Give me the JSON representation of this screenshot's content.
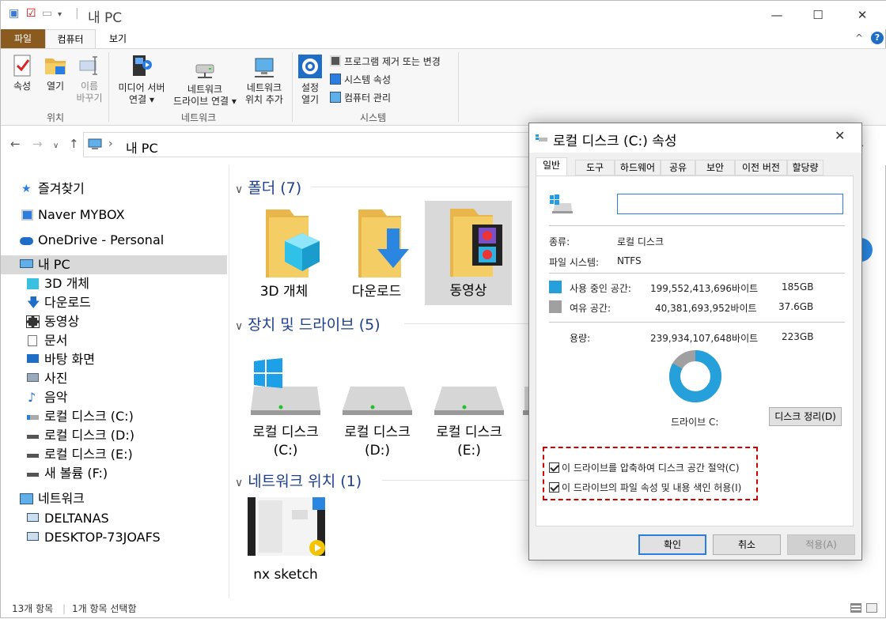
{
  "window": {
    "title": "내 PC",
    "minimize": "—",
    "maximize": "☐",
    "close": "✕"
  },
  "ribbon": {
    "tabs": [
      "파일",
      "컴퓨터",
      "보기"
    ],
    "buttons": {
      "properties": "속성",
      "open": "열기",
      "rename_1": "이름",
      "rename_2": "바꾸기",
      "media_1": "미디어 서버",
      "media_2": "연결",
      "netdrive_1": "네트워크",
      "netdrive_2": "드라이브 연결",
      "netloc_1": "네트워크",
      "netloc_2": "위치 추가",
      "settings_1": "설정",
      "settings_2": "열기",
      "uninstall": "프로그램 제거 또는 변경",
      "sysprops": "시스템 속성",
      "manage": "컴퓨터 관리"
    },
    "groups": {
      "location": "위치",
      "network": "네트워크",
      "system": "시스템"
    }
  },
  "address": {
    "path": "내 PC"
  },
  "nav_pane": {
    "items": [
      "즐겨찾기",
      "Naver MYBOX",
      "OneDrive - Personal",
      "내 PC",
      "3D 개체",
      "다운로드",
      "동영상",
      "문서",
      "바탕 화면",
      "사진",
      "음악",
      "로컬 디스크 (C:)",
      "로컬 디스크 (D:)",
      "로컬 디스크 (E:)",
      "새 볼륨 (F:)",
      "네트워크",
      "DELTANAS",
      "DESKTOP-73JOAFS"
    ]
  },
  "content": {
    "folders_header": "폴더 (7)",
    "folders": [
      "3D 개체",
      "다운로드",
      "동영상"
    ],
    "drives_header": "장치 및 드라이브 (5)",
    "drives": [
      {
        "line1": "로컬 디스크",
        "line2": "(C:)"
      },
      {
        "line1": "로컬 디스크",
        "line2": "(D:)"
      },
      {
        "line1": "로컬 디스크",
        "line2": "(E:)"
      }
    ],
    "network_header": "네트워크 위치 (1)",
    "network_item": "nx sketch"
  },
  "status": {
    "count": "13개 항목",
    "selected": "1개 항목 선택함"
  },
  "dialog": {
    "title": "로컬 디스크 (C:) 속성",
    "tabs": [
      "일반",
      "도구",
      "하드웨어",
      "공유",
      "보안",
      "이전 버전",
      "할당량"
    ],
    "name_value": "",
    "type_label": "종류:",
    "type_value": "로컬 디스크",
    "fs_label": "파일 시스템:",
    "fs_value": "NTFS",
    "used_label": "사용 중인 공간:",
    "used_bytes": "199,552,413,696바이트",
    "used_size": "185GB",
    "free_label": "여유 공간:",
    "free_bytes": "40,381,693,952바이트",
    "free_size": "37.6GB",
    "cap_label": "용량:",
    "cap_bytes": "239,934,107,648바이트",
    "cap_size": "223GB",
    "used_fraction": 0.832,
    "drive_label": "드라이브 C:",
    "cleanup": "디스크 정리(D)",
    "compress": "이 드라이브를 압축하여 디스크 공간 절약(C)",
    "index": "이 드라이브의 파일 속성 및 내용 색인 허용(I)",
    "ok": "확인",
    "cancel": "취소",
    "apply": "적용(A)",
    "colors": {
      "used": "#26a0da",
      "free": "#a0a0a0",
      "highlight": "#d10000"
    }
  }
}
